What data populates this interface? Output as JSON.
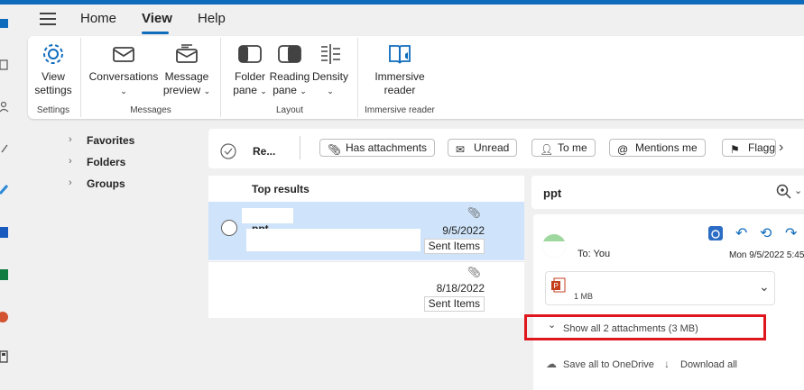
{
  "colors": {
    "accent": "#0f6cbd",
    "selected_row": "#cfe4fa",
    "highlight_box": "#e0161e"
  },
  "menu": {
    "tabs": [
      {
        "label": "Home"
      },
      {
        "label": "View"
      },
      {
        "label": "Help"
      }
    ],
    "active_tab": "View"
  },
  "ribbon": {
    "view_settings": "View\nsettings",
    "conversations": "Conversations",
    "message_preview": "Message\npreview",
    "folder_pane": "Folder\npane",
    "reading_pane": "Reading\npane",
    "density": "Density",
    "immersive_reader": "Immersive\nreader",
    "groups": {
      "settings": "Settings",
      "messages": "Messages",
      "layout": "Layout",
      "immersive": "Immersive reader"
    }
  },
  "nav": {
    "items": [
      {
        "label": "Favorites"
      },
      {
        "label": "Folders"
      },
      {
        "label": "Groups"
      }
    ]
  },
  "filters": {
    "truncated_label": "Re...",
    "chips": [
      {
        "label": "Has attachments",
        "icon": "paperclip-icon"
      },
      {
        "label": "Unread",
        "icon": "mail-icon"
      },
      {
        "label": "To me",
        "icon": "person-icon"
      },
      {
        "label": "Mentions me",
        "icon": "at-icon"
      },
      {
        "label": "Flagg",
        "icon": "flag-icon"
      }
    ]
  },
  "list": {
    "header": "Top results",
    "rows": [
      {
        "subject_fragment": "ppt",
        "date": "9/5/2022",
        "folder": "Sent Items"
      },
      {
        "date": "8/18/2022",
        "folder": "Sent Items"
      }
    ]
  },
  "reading": {
    "subject": "ppt",
    "to_line": "To: You",
    "sent": "Mon 9/5/2022 5:45",
    "attachment_size": "1 MB",
    "show_all": "Show all 2 attachments (3 MB)",
    "save_all": "Save all to OneDrive",
    "download_all": "Download all"
  }
}
